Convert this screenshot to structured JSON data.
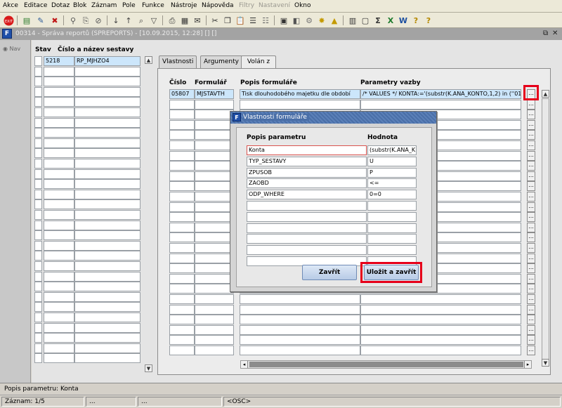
{
  "menu": [
    "Akce",
    "Editace",
    "Dotaz",
    "Blok",
    "Záznam",
    "Pole",
    "Funkce",
    "Nástroje",
    "Nápověda",
    "Filtry",
    "Nastavení",
    "Okno"
  ],
  "toolbar_icons": [
    "exit-icon",
    "insert-record-icon",
    "edit-record-icon",
    "delete-record-icon",
    "execute-query-icon",
    "enter-query-icon",
    "cancel-query-icon",
    "sort-asc-icon",
    "sort-desc-icon",
    "search-icon",
    "filter-icon",
    "print-icon",
    "report-icon",
    "email-icon",
    "cut-icon",
    "copy-icon",
    "paste-icon",
    "insert-row-icon",
    "delete-row-icon",
    "calendar-icon",
    "export-icon",
    "settings-icon",
    "star-icon",
    "alert-icon",
    "calculator-icon",
    "form-icon",
    "sum-icon",
    "excel-icon",
    "word-icon",
    "help-icon",
    "question-icon"
  ],
  "window": {
    "icon_letter": "F",
    "title": "00314 - Správa reportů (SPREPORTS) - [10.09.2015, 12:28]  []  []"
  },
  "nav": {
    "label": "Nav"
  },
  "list": {
    "header_stav": "Stav",
    "header_cislo": "Číslo a název sestavy",
    "rows": [
      {
        "code": "5218",
        "name": "RP_MJHZO4"
      }
    ]
  },
  "tabs": [
    "Vlastnosti",
    "Argumenty",
    "Volán z"
  ],
  "grid": {
    "headers": {
      "cislo": "Číslo",
      "formular": "Formulář",
      "popis": "Popis formuláře",
      "parametry": "Parametry vazby"
    },
    "rows": [
      {
        "cislo": "05807",
        "formular": "MJSTAVTH",
        "popis": "Tisk dlouhodobého majetku dle období",
        "parametry": "/* VALUES */ KONTA:='(substr(K.ANA_KONTO,1,2) in (''01''"
      }
    ],
    "dots_label": "..."
  },
  "dialog": {
    "icon_letter": "F",
    "title": "Vlastnosti formuláře",
    "header_param": "Popis parametru",
    "header_value": "Hodnota",
    "rows": [
      {
        "param": "Konta",
        "value": "(substr(K.ANA_K"
      },
      {
        "param": "TYP_SESTAVY",
        "value": "U"
      },
      {
        "param": "ZPUSOB",
        "value": "P"
      },
      {
        "param": "ZAOBD",
        "value": "<="
      },
      {
        "param": "ODP_WHERE",
        "value": "0=0"
      }
    ],
    "btn_close": "Zavřít",
    "btn_save": "Uložit a zavřít"
  },
  "status": {
    "hint": "Popis parametru: Konta",
    "record": "Záznam: 1/5",
    "box2": "...",
    "box3": "...",
    "osc": "<OSC>"
  }
}
